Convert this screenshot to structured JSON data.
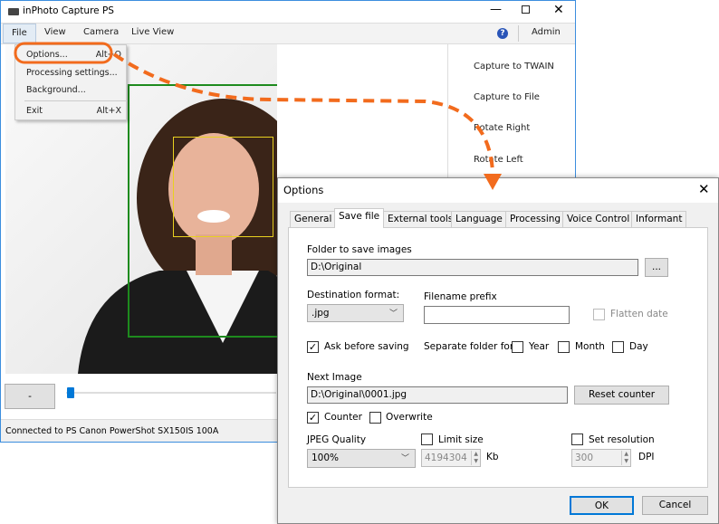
{
  "app": {
    "title": "inPhoto Capture PS",
    "admin": "Admin",
    "help_icon": "help-icon"
  },
  "menu": [
    "File",
    "View",
    "Camera",
    "Live View"
  ],
  "file_menu": [
    {
      "label": "Options...",
      "shortcut": "Alt+O"
    },
    {
      "label": "Processing settings...",
      "shortcut": ""
    },
    {
      "label": "Background...",
      "shortcut": ""
    },
    {
      "label": "Exit",
      "shortcut": "Alt+X"
    }
  ],
  "right_panel": [
    "Capture to TWAIN",
    "Capture to File",
    "Rotate Right",
    "Rotate Left"
  ],
  "zoom_button": "-",
  "slider_value": 0,
  "status": "Connected to PS Canon PowerShot SX150IS 100A",
  "annotation_color": "#f26b1d",
  "dialog": {
    "title": "Options",
    "tabs": [
      "General",
      "Save file",
      "External tools",
      "Language",
      "Processing",
      "Voice Control",
      "Informant"
    ],
    "active_tab": "Save file",
    "folder_label": "Folder to save images",
    "folder_value": "D:\\Original",
    "browse": "...",
    "dest_format_label": "Destination format:",
    "dest_format_value": ".jpg",
    "prefix_label": "Filename prefix",
    "prefix_value": "",
    "flatten_date": "Flatten date",
    "ask_before_saving": "Ask before saving",
    "separate_folder": "Separate folder for",
    "year": "Year",
    "month": "Month",
    "day": "Day",
    "next_image_label": "Next Image",
    "next_image_value": "D:\\Original\\0001.jpg",
    "reset_counter": "Reset counter",
    "counter": "Counter",
    "overwrite": "Overwrite",
    "jpeg_quality_label": "JPEG Quality",
    "jpeg_quality_value": "100%",
    "limit_size": "Limit size",
    "limit_size_value": "4194304",
    "kb": "Kb",
    "set_resolution": "Set resolution",
    "resolution_value": "300",
    "dpi": "DPI",
    "ok": "OK",
    "cancel": "Cancel",
    "check_mark": "✓"
  }
}
